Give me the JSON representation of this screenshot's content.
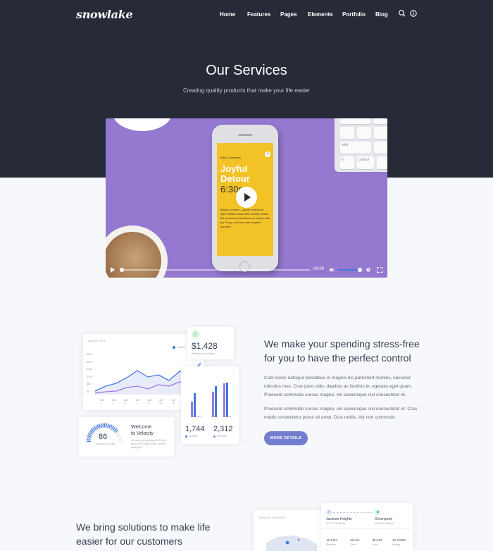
{
  "header": {
    "logo": "snowlake",
    "nav": [
      "Home",
      "Features",
      "Pages",
      "Elements",
      "Portfolio",
      "Blog"
    ],
    "icons": [
      "search-icon",
      "info-icon"
    ]
  },
  "hero": {
    "title": "Our Services",
    "subtitle": "Creating quality products that make your life easier"
  },
  "video": {
    "phone_screen": {
      "tag": "Why & Wellness",
      "title_line1": "Joyful",
      "title_line2": "Detour",
      "time": "6:30p",
      "body": "Break a routine – go left instead of right. Studies show that novelty boosts the serotonin that floods our brains with joy. So go out there and surprise yourself."
    },
    "keys": [
      "shift",
      "fn",
      "control"
    ],
    "current_time": "00:09",
    "progress": 0.01,
    "volume": 0.87
  },
  "dashboard": {
    "chart_card": {
      "title": "ANALYTICS",
      "legend": "Direct",
      "y_ticks": [
        "$25k",
        "$20k",
        "$15k",
        "$10k",
        "$5k",
        "$0"
      ],
      "x_ticks": [
        "Mar 1",
        "Mar 3",
        "Mar 5",
        "Mar 7",
        "Mar 9",
        "Apr 11",
        "Apr 13",
        "Apr 15",
        "Apr 17",
        "Apr 19"
      ]
    },
    "stat_card": {
      "value": "$1,428",
      "caption": "Withdraw out of bank"
    },
    "bars_card": {
      "x_labels": [
        "April",
        "May",
        "June"
      ],
      "stat1": {
        "value": "1,744",
        "label": "Comfort"
      },
      "stat2": {
        "value": "2,312",
        "label": "Premium"
      }
    },
    "gauge_card": {
      "value": "86",
      "value_label": "UPCOMING TOURS",
      "title_line1": "Welcome",
      "title_line2": "to Velocity",
      "desc": "We are on a journey with Prime since 1,475 days so far, and still going well."
    }
  },
  "section1": {
    "heading_line1": "We make your spending stress-free",
    "heading_line2": "for you to have the perfect control",
    "para1_line1": "Cum sociis natoque penatibus et magnis dis parturient montes, nascetur",
    "para1_line2": "ridiculus mus. Cras justo odio, dapibus ac facilisis in, egestas eget quam.",
    "para1_line3": "Praesent commodo cursus magna, vel scelerisque nisl consectetur et.",
    "para2_line1": "Praesent commodo cursus magna, vel scelerisque nisl consectetur et. Cras",
    "para2_line2": "mattis consectetur purus sit amet. Duis mollis, est non commodo.",
    "button": "MORE DETAILS"
  },
  "section2": {
    "heading_line1": "We bring solutions to make life",
    "heading_line2": "easier for our customers",
    "map_label": "SENSOR CENTERS",
    "trip": {
      "from": "Jackson Heights",
      "from_sub": "37-27 74th Street",
      "to": "Greenpoint",
      "to_sub": "53 Eckford Street",
      "stats": [
        {
          "value": "12.3 km",
          "label": "Distance"
        },
        {
          "value": "42 min",
          "label": "Time"
        },
        {
          "value": "$14.20",
          "label": "Price"
        },
        {
          "value": "12.4 kWh",
          "label": "Energy"
        }
      ]
    }
  },
  "colors": {
    "hero_bg": "#262b37",
    "accent": "#747ed1",
    "video_bg": "#9578cf",
    "phone_screen": "#f3c227",
    "chart_blue": "#3f78e0",
    "chart_purple": "#9d78e0"
  }
}
